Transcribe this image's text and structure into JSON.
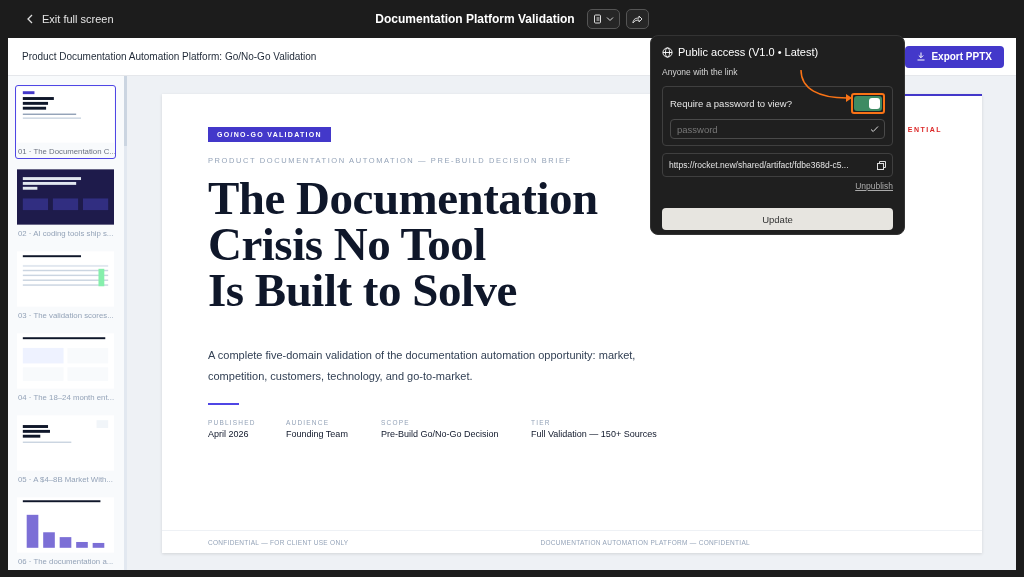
{
  "window": {
    "back_label": "Exit full screen",
    "title": "Documentation Platform Validation"
  },
  "header": {
    "title": "Product Documentation Automation Platform: Go/No-Go Validation",
    "export_label": "Export PPTX"
  },
  "slides": [
    {
      "label": "01 · The Documentation C...",
      "selected": true,
      "kind": "title"
    },
    {
      "label": "02 · AI coding tools ship s...",
      "selected": false,
      "kind": "dark"
    },
    {
      "label": "03 · The validation scores...",
      "selected": false,
      "kind": "table"
    },
    {
      "label": "04 · The 18–24 month ent...",
      "selected": false,
      "kind": "cards"
    },
    {
      "label": "05 · A $4–8B Market With...",
      "selected": false,
      "kind": "market"
    },
    {
      "label": "06 · The documentation a...",
      "selected": false,
      "kind": "chart"
    }
  ],
  "slide": {
    "badge": "GO/NO-GO VALIDATION",
    "eyebrow": "PRODUCT DOCUMENTATION AUTOMATION — PRE-BUILD DECISION BRIEF",
    "corner_tag": "ENTIAL",
    "title_lines": [
      "The Documentation",
      "Crisis No Tool",
      "Is Built to Solve"
    ],
    "summary": "A complete five-domain validation of the documentation automation opportunity: market, competition, customers, technology, and go-to-market.",
    "meta": [
      {
        "label": "PUBLISHED",
        "value": "April 2026"
      },
      {
        "label": "AUDIENCE",
        "value": "Founding Team"
      },
      {
        "label": "SCOPE",
        "value": "Pre-Build Go/No-Go Decision"
      },
      {
        "label": "TIER",
        "value": "Full Validation — 150+ Sources"
      }
    ],
    "footer_left": "CONFIDENTIAL — FOR CLIENT USE ONLY",
    "footer_right": "DOCUMENTATION AUTOMATION PLATFORM — CONFIDENTIAL"
  },
  "share_popover": {
    "title": "Public access (V1.0 • Latest)",
    "subtitle": "Anyone with the link",
    "password_toggle": {
      "label": "Require a password to view?",
      "on": true
    },
    "password_placeholder": "password",
    "link": "https://rocket.new/shared/artifact/fdbe368d-c5...",
    "unpublish": "Unpublish",
    "update": "Update"
  }
}
